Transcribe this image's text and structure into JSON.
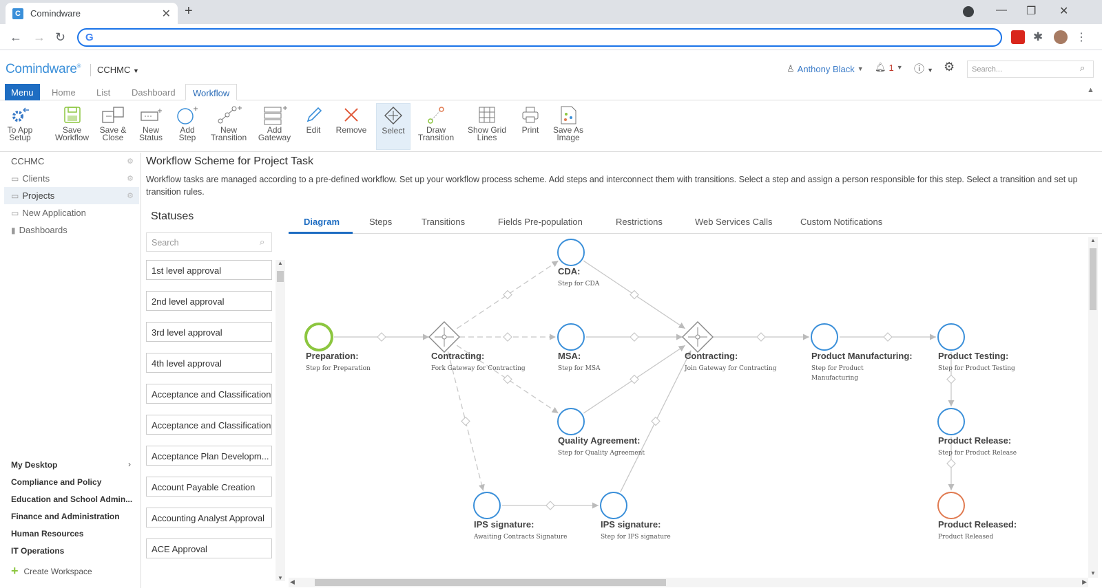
{
  "browser": {
    "tab_title": "Comindware",
    "tab_favicon": "C",
    "omnibox_icon": "G"
  },
  "app": {
    "logo": "Comindware",
    "org": "CCHMC",
    "user": "Anthony Black",
    "notifications": "1",
    "search_placeholder": "Search..."
  },
  "menu_tabs": [
    "Menu",
    "Home",
    "List",
    "Dashboard",
    "Workflow"
  ],
  "ribbon": [
    {
      "l1": "To App",
      "l2": "Setup",
      "icon": "gear-arrow-icon"
    },
    {
      "l1": "Save",
      "l2": "Workflow",
      "icon": "save-icon"
    },
    {
      "l1": "Save &",
      "l2": "Close",
      "icon": "save-close-icon"
    },
    {
      "l1": "New",
      "l2": "Status",
      "icon": "new-status-icon"
    },
    {
      "l1": "Add",
      "l2": "Step",
      "icon": "add-step-icon"
    },
    {
      "l1": "New",
      "l2": "Transition",
      "icon": "new-transition-icon"
    },
    {
      "l1": "Add",
      "l2": "Gateway",
      "icon": "add-gateway-icon"
    },
    {
      "l1": "Edit",
      "l2": "",
      "icon": "pencil-icon"
    },
    {
      "l1": "Remove",
      "l2": "",
      "icon": "remove-icon"
    },
    {
      "l1": "Select",
      "l2": "",
      "icon": "select-icon"
    },
    {
      "l1": "Draw",
      "l2": "Transition",
      "icon": "draw-transition-icon"
    },
    {
      "l1": "Show Grid",
      "l2": "Lines",
      "icon": "grid-icon"
    },
    {
      "l1": "Print",
      "l2": "",
      "icon": "print-icon"
    },
    {
      "l1": "Save As",
      "l2": "Image",
      "icon": "save-image-icon"
    }
  ],
  "sidebar": {
    "items": [
      "CCHMC",
      "Clients",
      "Projects",
      "New Application",
      "Dashboards"
    ],
    "bottom": [
      "My Desktop",
      "Compliance and Policy",
      "Education and School Admin...",
      "Finance and Administration",
      "Human Resources",
      "IT Operations"
    ],
    "create": "Create Workspace"
  },
  "page": {
    "title": "Workflow Scheme for Project Task",
    "description": "Workflow tasks are managed according to a pre-defined workflow. Set up your workflow process scheme. Add steps and interconnect them with transitions. Select a step and assign a person responsible for this step. Select a transition and set up transition rules."
  },
  "statuses": {
    "title": "Statuses",
    "search_placeholder": "Search",
    "items": [
      "1st level approval",
      "2nd level approval",
      "3rd level approval",
      "4th level approval",
      "Acceptance and Classification",
      "Acceptance and Classification",
      "Acceptance Plan Developm...",
      "Account Payable Creation",
      "Accounting Analyst Approval",
      "ACE Approval"
    ]
  },
  "diagram_tabs": [
    "Diagram",
    "Steps",
    "Transitions",
    "Fields Pre-population",
    "Restrictions",
    "Web Services Calls",
    "Custom Notifications"
  ],
  "diagram": {
    "nodes": [
      {
        "id": "prep",
        "label": "Preparation:",
        "sub": "Step for Preparation",
        "kind": "start"
      },
      {
        "id": "fork",
        "label": "Contracting:",
        "sub": "Fork Gateway for Contracting",
        "kind": "gateway"
      },
      {
        "id": "cda",
        "label": "CDA:",
        "sub": "Step for CDA",
        "kind": "step"
      },
      {
        "id": "msa",
        "label": "MSA:",
        "sub": "Step for MSA",
        "kind": "step"
      },
      {
        "id": "qa",
        "label": "Quality Agreement:",
        "sub": "Step for Quality Agreement",
        "kind": "step"
      },
      {
        "id": "join",
        "label": "Contracting:",
        "sub": "Join Gateway for Contracting",
        "kind": "gateway"
      },
      {
        "id": "pm",
        "label": "Product Manufacturing:",
        "sub": "Step for Product",
        "sub2": "Manufacturing",
        "kind": "step"
      },
      {
        "id": "pt",
        "label": "Product Testing:",
        "sub": "Step for Product Testing",
        "kind": "step"
      },
      {
        "id": "pr",
        "label": "Product Release:",
        "sub": "Step for Product Release",
        "kind": "step"
      },
      {
        "id": "prd",
        "label": "Product Released:",
        "sub": "Product Released",
        "kind": "end"
      },
      {
        "id": "ips1",
        "label": "IPS signature:",
        "sub": "Awaiting Contracts Signature",
        "kind": "step"
      },
      {
        "id": "ips2",
        "label": "IPS signature:",
        "sub": "Step for IPS signature",
        "kind": "step"
      }
    ],
    "edges": [
      {
        "from": "prep",
        "to": "fork",
        "dashed": false
      },
      {
        "from": "fork",
        "to": "cda",
        "dashed": true
      },
      {
        "from": "fork",
        "to": "msa",
        "dashed": true
      },
      {
        "from": "fork",
        "to": "qa",
        "dashed": true
      },
      {
        "from": "fork",
        "to": "ips1",
        "dashed": true
      },
      {
        "from": "cda",
        "to": "join",
        "dashed": false
      },
      {
        "from": "msa",
        "to": "join",
        "dashed": false
      },
      {
        "from": "qa",
        "to": "join",
        "dashed": false
      },
      {
        "from": "ips2",
        "to": "join",
        "dashed": false
      },
      {
        "from": "ips1",
        "to": "ips2",
        "dashed": false
      },
      {
        "from": "join",
        "to": "pm",
        "dashed": false
      },
      {
        "from": "pm",
        "to": "pt",
        "dashed": false
      },
      {
        "from": "pt",
        "to": "pr",
        "dashed": false
      },
      {
        "from": "pr",
        "to": "prd",
        "dashed": false
      }
    ]
  },
  "colors": {
    "accent": "#1e6dc2",
    "step": "#3a8fd9",
    "start": "#8cc63f",
    "end": "#e07a50"
  }
}
